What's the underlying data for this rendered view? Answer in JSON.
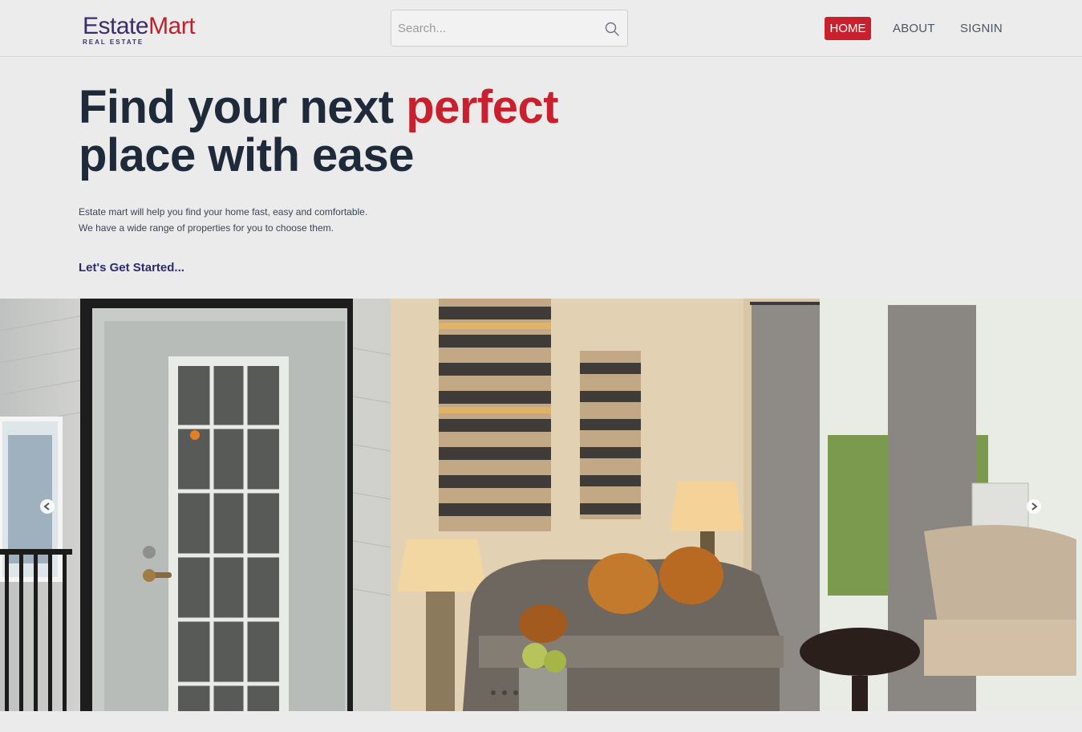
{
  "brand": {
    "name_part1": "Estate",
    "name_part2": "Mart",
    "tagline": "REAL ESTATE"
  },
  "search": {
    "placeholder": "Search..."
  },
  "nav": {
    "home": "HOME",
    "about": "ABOUT",
    "signin": "SIGNIN"
  },
  "hero": {
    "title_prefix": "Find your next ",
    "title_accent": "perfect",
    "title_line2": "place with ease",
    "description_line1": "Estate mart will help you find your home fast, easy and comfortable.",
    "description_line2": "We have a wide range of properties for you to choose them.",
    "cta": "Let's Get Started..."
  },
  "colors": {
    "accent": "#c8202c",
    "brand_dark": "#3d2e6b",
    "cta": "#2d2a6e",
    "page_bg": "#ebebeb"
  },
  "icons": {
    "search": "search-icon",
    "prev": "chevron-left-icon",
    "next": "chevron-right-icon"
  }
}
